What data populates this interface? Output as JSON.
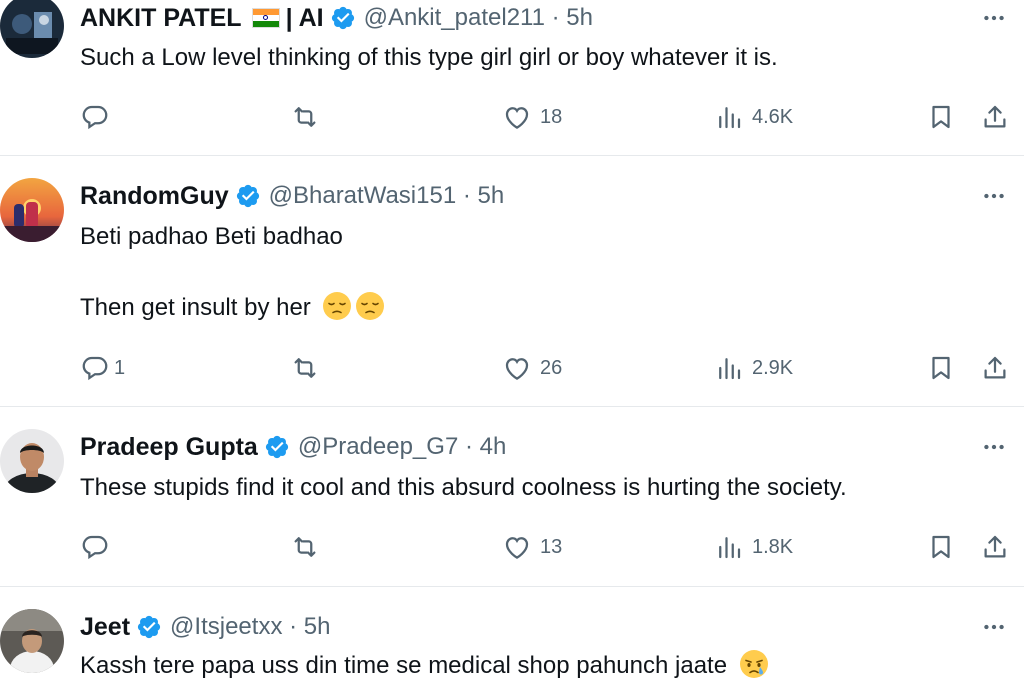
{
  "colors": {
    "verified": "#1d9bf0",
    "text": "#0f1419",
    "secondary": "#536471",
    "divider": "#e6e9ec"
  },
  "tweets": [
    {
      "name": "ANKIT PATEL",
      "name_suffix": "| AI",
      "handle": "@Ankit_patel211 · 5h",
      "lines": [
        "Such a Low level thinking of this type girl girl or boy whatever it is."
      ],
      "reply_count": "",
      "like_count": "18",
      "view_count": "4.6K"
    },
    {
      "name": "RandomGuy",
      "handle": "@BharatWasi151 · 5h",
      "lines": [
        "Beti padhao Beti badhao",
        "Then get insult by her"
      ],
      "reply_count": "1",
      "like_count": "26",
      "view_count": "2.9K"
    },
    {
      "name": "Pradeep Gupta",
      "handle": "@Pradeep_G7 · 4h",
      "lines": [
        "These stupids find it cool and this absurd coolness is hurting the society."
      ],
      "reply_count": "",
      "like_count": "13",
      "view_count": "1.8K"
    },
    {
      "name": "Jeet",
      "handle": "@Itsjeetxx · 5h",
      "lines": [
        "Kassh tere papa uss din time se medical shop pahunch jaate"
      ]
    }
  ]
}
